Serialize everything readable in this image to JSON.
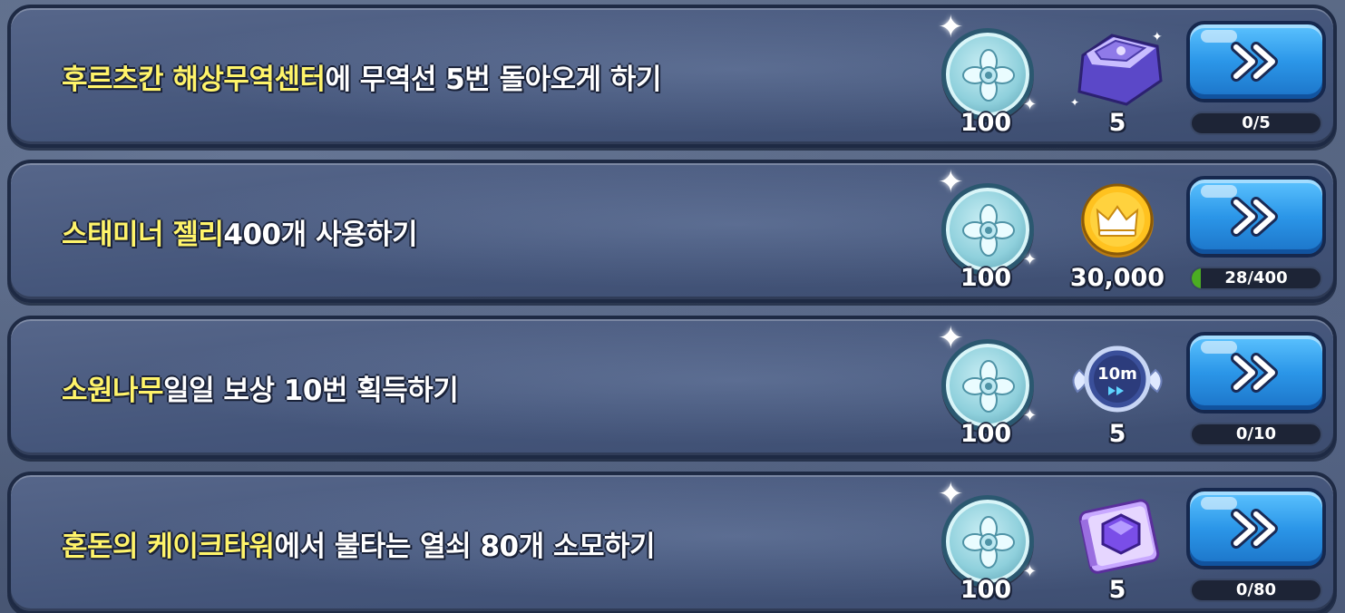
{
  "missions": [
    {
      "title_highlight": "후르츠칸 해상무역센터",
      "title_rest": "에 무역선 5번 돌아오게 하기",
      "shell_reward": "100",
      "item_icon": "purple-crystal-tablet-icon",
      "item_amount": "5",
      "progress_text": "0/5",
      "progress_current": 0,
      "progress_total": 5
    },
    {
      "title_highlight": "스태미너 젤리",
      "title_rest": " 400개 사용하기",
      "shell_reward": "100",
      "item_icon": "gold-crown-coin-icon",
      "item_amount": "30,000",
      "progress_text": "28/400",
      "progress_current": 28,
      "progress_total": 400
    },
    {
      "title_highlight": "소원나무",
      "title_rest": " 일일 보상 10번 획득하기",
      "shell_reward": "100",
      "item_icon": "10m-speedup-ticket-icon",
      "item_amount": "5",
      "item_label": "10m",
      "progress_text": "0/10",
      "progress_current": 0,
      "progress_total": 10
    },
    {
      "title_highlight": "혼돈의 케이크타워",
      "title_rest": "에서 불타는 열쇠 80개 소모하기",
      "shell_reward": "100",
      "item_icon": "purple-gem-card-icon",
      "item_amount": "5",
      "progress_text": "0/80",
      "progress_current": 0,
      "progress_total": 80
    }
  ],
  "colors": {
    "highlight": "#fff46a",
    "button": "#2b96e8",
    "progress_fill": "#4bad22"
  }
}
